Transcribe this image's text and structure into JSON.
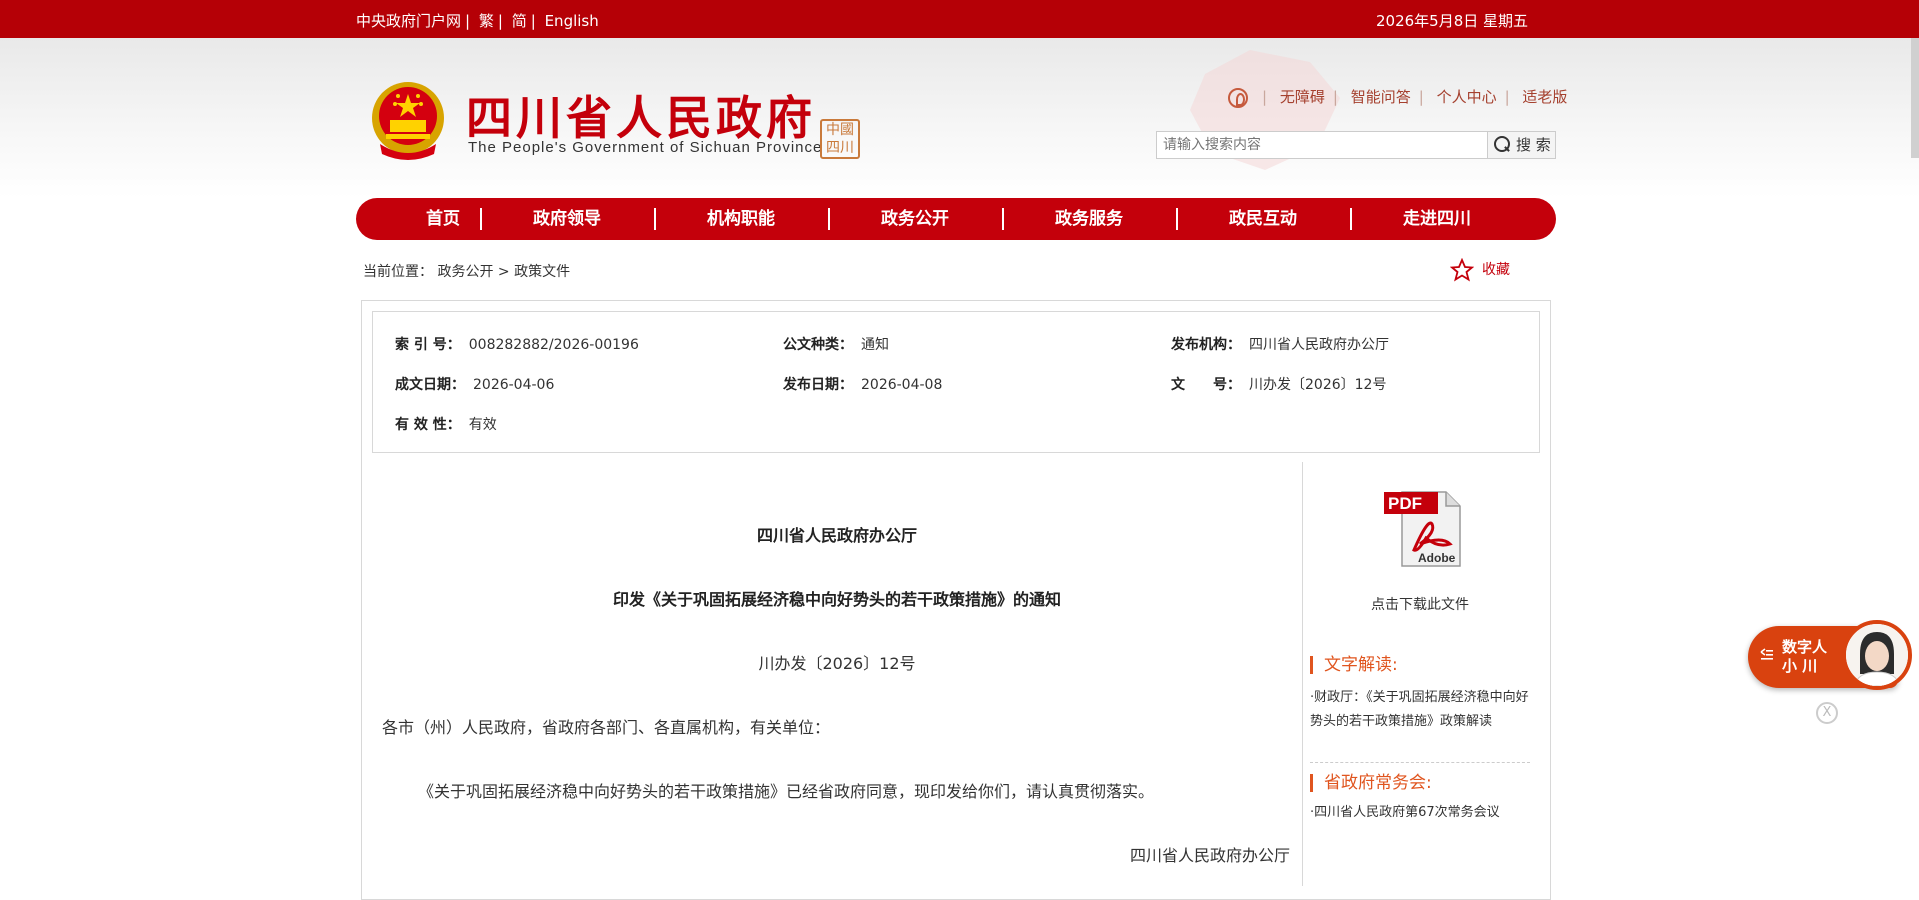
{
  "topbar": {
    "links": [
      "中央政府门户网",
      "繁",
      "简",
      "English"
    ],
    "separator": "|",
    "date": "2026年5月8日 星期五"
  },
  "header": {
    "title": "四川省人民政府",
    "subtitle": "The People's Government of Sichuan Province",
    "seal_text": "中國四川",
    "quicklinks": [
      "无障碍",
      "智能问答",
      "个人中心",
      "适老版"
    ],
    "search_placeholder": "请输入搜索内容",
    "search_button": "搜 索"
  },
  "nav": {
    "items": [
      "首页",
      "政府领导",
      "机构职能",
      "政务公开",
      "政务服务",
      "政民互动",
      "走进四川"
    ]
  },
  "breadcrumb": {
    "label": "当前位置：",
    "path": [
      "政务公开",
      "政策文件"
    ],
    "separator": ">"
  },
  "favorite": {
    "label": "收藏"
  },
  "doc_info": {
    "index_no": {
      "key": "索 引 号：",
      "value": "008282882/2026-00196"
    },
    "doc_type": {
      "key": "公文种类：",
      "value": "通知"
    },
    "issuer": {
      "key": "发布机构：",
      "value": "四川省人民政府办公厅"
    },
    "created": {
      "key": "成文日期：",
      "value": "2026-04-06"
    },
    "published": {
      "key": "发布日期：",
      "value": "2026-04-08"
    },
    "doc_no": {
      "key": "文　　号：",
      "value": "川办发〔2026〕12号"
    },
    "validity": {
      "key": "有 效 性：",
      "value": "有效"
    }
  },
  "document": {
    "issuer": "四川省人民政府办公厅",
    "title": "印发《关于巩固拓展经济稳中向好势头的若干政策措施》的通知",
    "number": "川办发〔2026〕12号",
    "recipients": "各市（州）人民政府，省政府各部门、各直属机构，有关单位：",
    "body": "《关于巩固拓展经济稳中向好势头的若干政策措施》已经省政府同意，现印发给你们，请认真贯彻落实。",
    "signature": "四川省人民政府办公厅"
  },
  "sidebar": {
    "pdf_label": "PDF",
    "adobe_label": "Adobe",
    "download_text": "点击下载此文件",
    "interpretation_heading": "文字解读:",
    "interpretation_link": "·财政厅：《关于巩固拓展经济稳中向好势头的若干政策措施》政策解读",
    "meeting_heading": "省政府常务会:",
    "meeting_link": "·四川省人民政府第67次常务会议"
  },
  "digital_assistant": {
    "line1": "数字人",
    "line2": "小 川",
    "close": "X"
  },
  "colors": {
    "brand_red": "#c4000b",
    "topbar_red": "#b50006",
    "accent_orange": "#e0551f"
  }
}
